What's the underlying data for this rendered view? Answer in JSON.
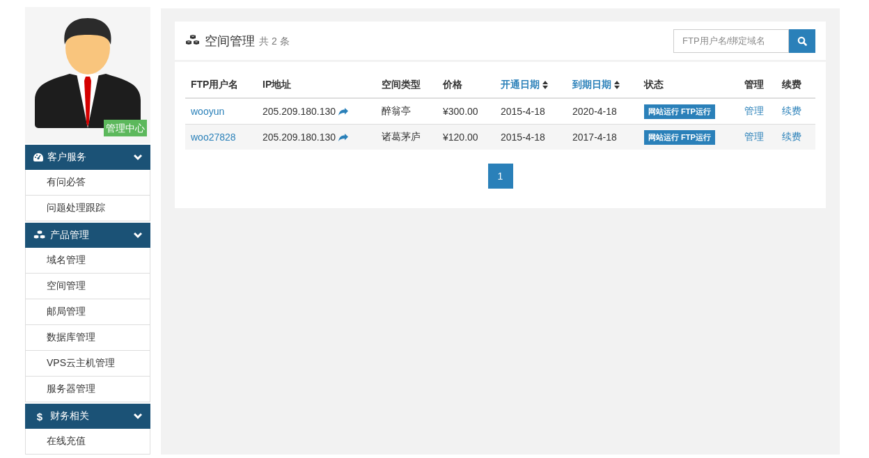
{
  "profile": {
    "badge": "管理中心"
  },
  "sidebar": {
    "sections": [
      {
        "icon": {
          "kind": "dashboard"
        },
        "title": "客户服务",
        "expanded": true,
        "items": [
          "有问必答",
          "问题处理跟踪"
        ]
      },
      {
        "icon": {
          "kind": "cubes"
        },
        "title": "产品管理",
        "expanded": true,
        "items": [
          "域名管理",
          "空间管理",
          "邮局管理",
          "数据库管理",
          "VPS云主机管理",
          "服务器管理"
        ]
      },
      {
        "icon": {
          "kind": "glyph",
          "text": "$"
        },
        "title": "财务相关",
        "expanded": true,
        "items": [
          "在线充值"
        ]
      }
    ]
  },
  "panel": {
    "title": "空间管理",
    "count": "共 2 条",
    "search": {
      "placeholder": "FTP用户名/绑定域名"
    }
  },
  "table": {
    "columns": [
      {
        "label": "FTP用户名",
        "sortable": false
      },
      {
        "label": "IP地址",
        "sortable": false
      },
      {
        "label": "空间类型",
        "sortable": false
      },
      {
        "label": "价格",
        "sortable": false
      },
      {
        "label": "开通日期",
        "sortable": true
      },
      {
        "label": "到期日期",
        "sortable": true
      },
      {
        "label": "状态",
        "sortable": false
      },
      {
        "label": "管理",
        "sortable": false
      },
      {
        "label": "续费",
        "sortable": false
      }
    ],
    "rows": [
      {
        "username": "wooyun",
        "ip": "205.209.180.130",
        "type": "醉翁亭",
        "price": "¥300.00",
        "start": "2015-4-18",
        "end": "2020-4-18",
        "status": "网站运行 FTP运行",
        "manage": "管理",
        "renew": "续费"
      },
      {
        "username": "woo27828",
        "ip": "205.209.180.130",
        "type": "诸葛茅庐",
        "price": "¥120.00",
        "start": "2015-4-18",
        "end": "2017-4-18",
        "status": "网站运行 FTP运行",
        "manage": "管理",
        "renew": "续费"
      }
    ]
  },
  "pagination": [
    {
      "label": "1",
      "selected": true
    }
  ]
}
